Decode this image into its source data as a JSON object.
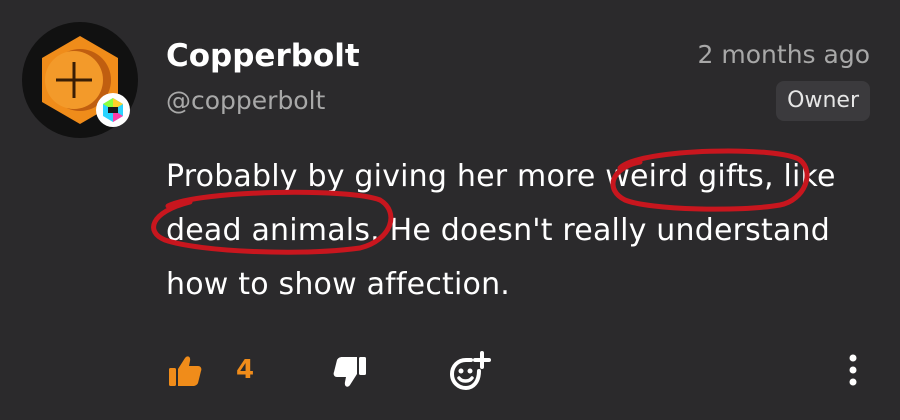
{
  "comment": {
    "author": {
      "display_name": "Copperbolt",
      "handle": "@copperbolt",
      "role": "Owner",
      "avatar_icon": "copper-screw-head-icon",
      "badge_icon": "hexagon-badge-icon"
    },
    "timestamp": "2 months ago",
    "body": "Probably by giving her more weird gifts, like dead animals. He doesn't really understand how to show affection.",
    "reactions": {
      "like_icon": "thumbs-up-icon",
      "like_count": "4",
      "dislike_icon": "thumbs-down-icon",
      "react_icon": "add-emoji-icon",
      "more_icon": "more-vertical-icon"
    }
  },
  "markup_annotations": {
    "color": "#c8161e",
    "circled_phrases": [
      "weird gifts,",
      "dead animals."
    ]
  },
  "colors": {
    "background": "#2b2a2c",
    "accent": "#f08c1a",
    "secondary_text": "#a8a8a8",
    "badge_background": "#3b3a3d"
  }
}
